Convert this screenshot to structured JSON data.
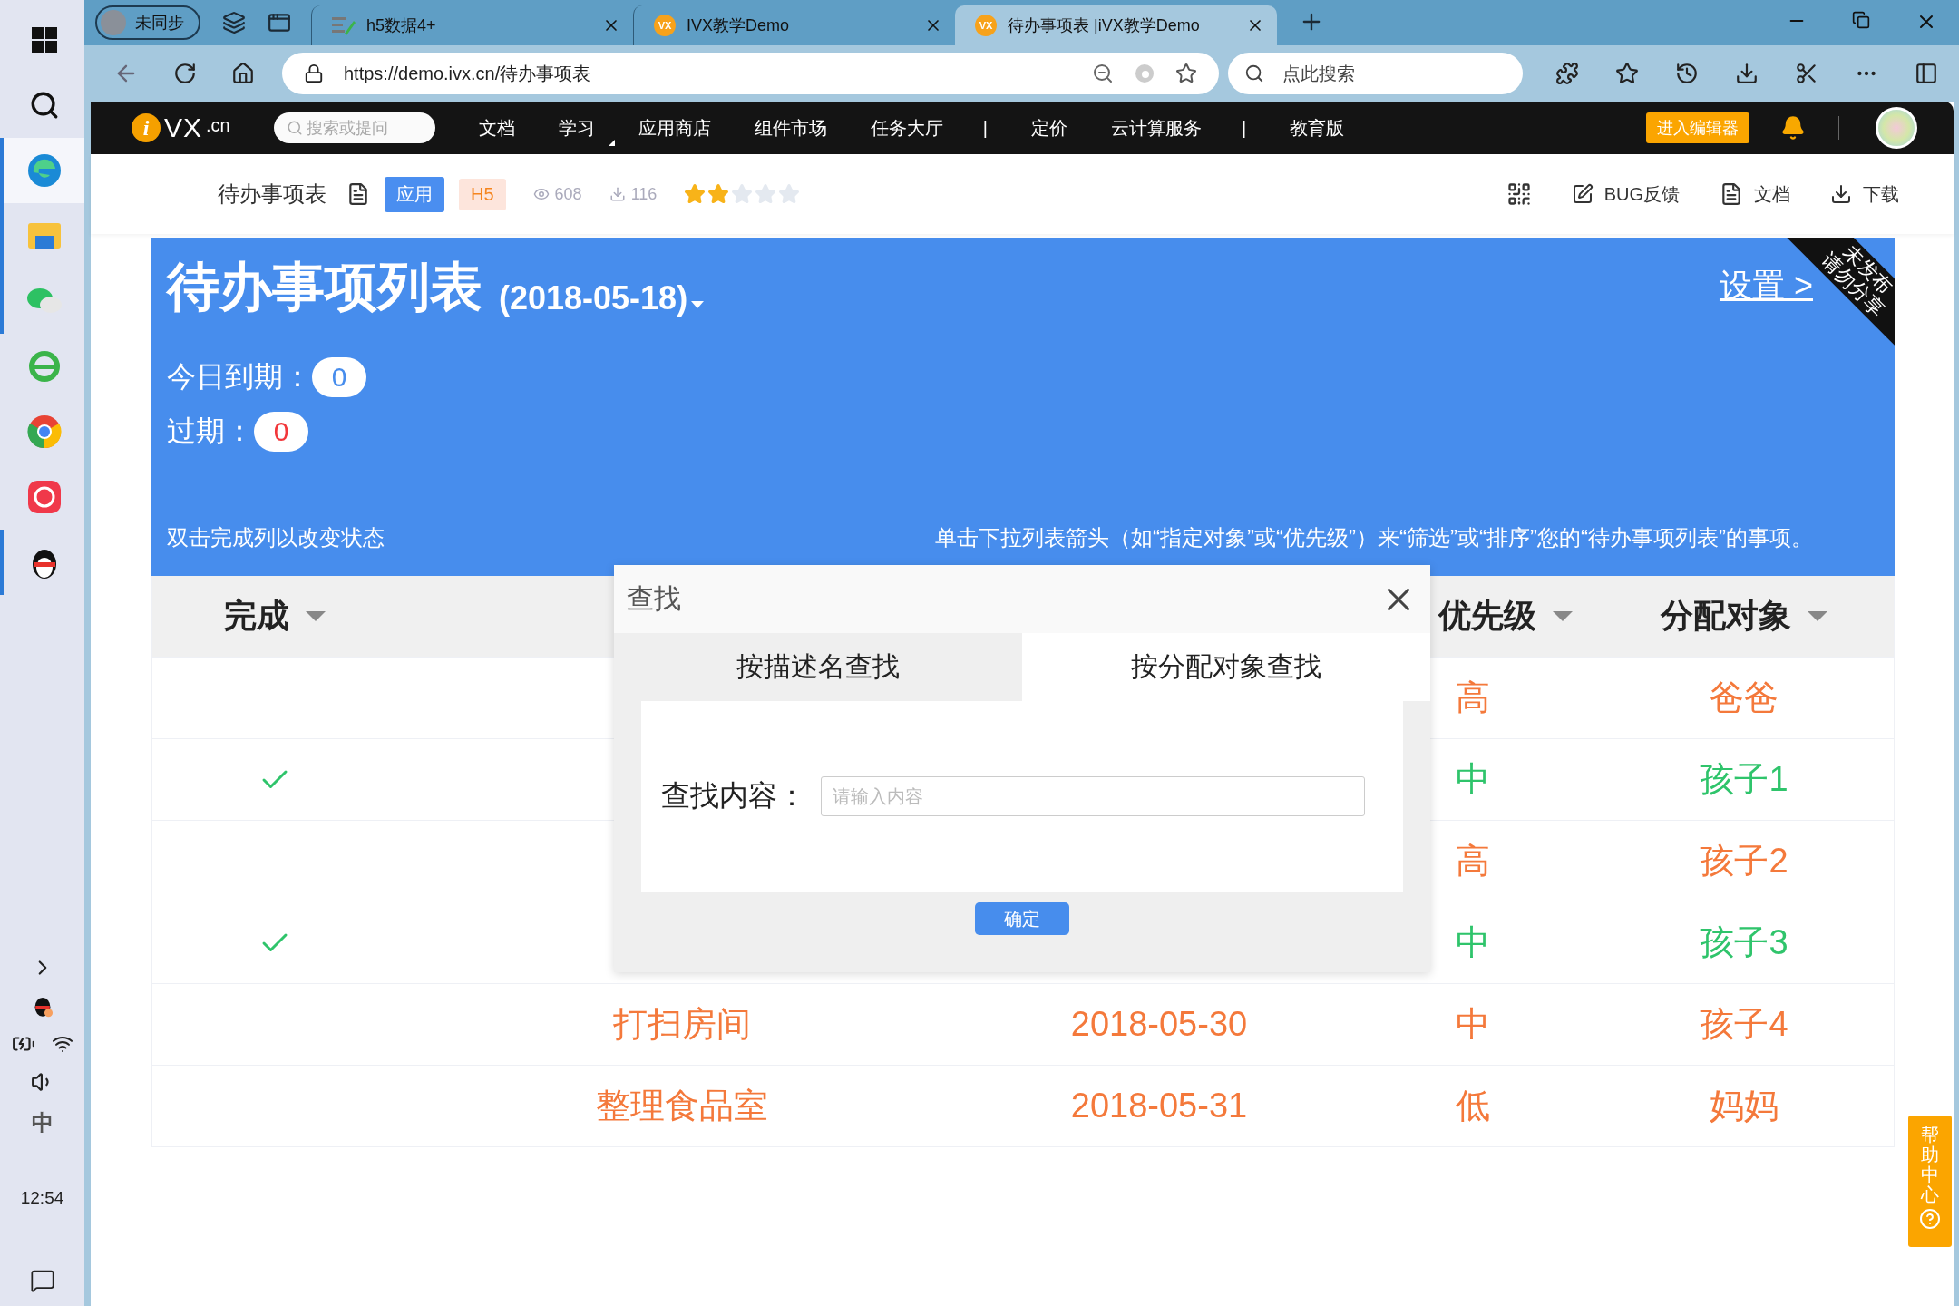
{
  "taskbar": {
    "apps": [
      {
        "kind": "edge",
        "running": true
      },
      {
        "kind": "folder",
        "running": true
      },
      {
        "kind": "wechat",
        "running": true
      },
      {
        "kind": "ie",
        "running": false
      },
      {
        "kind": "chrome",
        "running": false
      },
      {
        "kind": "redapp",
        "running": false
      },
      {
        "kind": "qq",
        "running": true
      }
    ],
    "ime": "中",
    "time": "12:54"
  },
  "browser": {
    "profile": "未同步",
    "tabs": [
      {
        "title": "h5数据4+",
        "selected": false,
        "kind": "sheet"
      },
      {
        "title": "IVX教学Demo",
        "selected": false,
        "kind": "vx",
        "icon_text": "VX"
      },
      {
        "title": "待办事项表 |iVX教学Demo",
        "selected": true,
        "kind": "vx",
        "icon_text": "VX"
      }
    ],
    "url": "https://demo.ivx.cn/待办事项表",
    "search_placeholder": "点此搜索"
  },
  "nav": {
    "logo": {
      "mark": "i",
      "name": "VX",
      "suffix": ".cn"
    },
    "search_placeholder": "搜索或提问",
    "items": [
      {
        "label": "文档",
        "kind": "link"
      },
      {
        "label": "学习",
        "kind": "menu"
      },
      {
        "label": "应用商店",
        "kind": "link"
      },
      {
        "label": "组件市场",
        "kind": "link"
      },
      {
        "label": "任务大厅",
        "kind": "link"
      },
      {
        "label": "|",
        "kind": "separator"
      },
      {
        "label": "定价",
        "kind": "link"
      },
      {
        "label": "云计算服务",
        "kind": "link"
      },
      {
        "label": "|",
        "kind": "separator"
      },
      {
        "label": "教育版",
        "kind": "link"
      }
    ],
    "editor_button": "进入编辑器"
  },
  "subheader": {
    "title": "待办事项表",
    "badges": [
      {
        "label": "应用",
        "kind": "app"
      },
      {
        "label": "H5",
        "kind": "h5"
      }
    ],
    "views": "608",
    "downloads": "116",
    "stars": 2,
    "actions": [
      {
        "label": "BUG反馈",
        "kind": "bug"
      },
      {
        "label": "文档",
        "kind": "doc"
      },
      {
        "label": "下载",
        "kind": "download"
      }
    ]
  },
  "banner": {
    "title": "待办事项列表",
    "date": "(2018-05-18)",
    "settings_link": "设置 >",
    "ribbon": [
      "未发布",
      "请勿分享"
    ],
    "counters": [
      {
        "label": "今日到期：",
        "value": "0",
        "kind": "today"
      },
      {
        "label": "过期：",
        "value": "0",
        "kind": "overdue"
      }
    ],
    "hint_left": "双击完成列以改变状态",
    "hint_right": "单击下拉列表箭头（如“指定对象”或“优先级”）来“筛选”或“排序”您的“待办事项列表”的事项。"
  },
  "table": {
    "columns": {
      "done": "完成",
      "priority": "优先级",
      "assignee": "分配对象"
    },
    "rows": [
      {
        "done": false,
        "priority": "高",
        "assignee": "爸爸"
      },
      {
        "done": true,
        "priority": "中",
        "assignee": "孩子1"
      },
      {
        "done": false,
        "priority": "高",
        "assignee": "孩子2"
      },
      {
        "done": true,
        "priority": "中",
        "assignee": "孩子3"
      },
      {
        "done": false,
        "task": "打扫房间",
        "due": "2018-05-30",
        "priority": "中",
        "assignee": "孩子4"
      },
      {
        "done": false,
        "task": "整理食品室",
        "due": "2018-05-31",
        "priority": "低",
        "assignee": "妈妈"
      }
    ]
  },
  "dialog": {
    "title": "查找",
    "tabs": [
      {
        "label": "按描述名查找",
        "selected": false
      },
      {
        "label": "按分配对象查找",
        "selected": true
      }
    ],
    "field_label": "查找内容：",
    "placeholder": "请输入内容",
    "confirm": "确定"
  },
  "help": {
    "label": "帮助中心"
  }
}
